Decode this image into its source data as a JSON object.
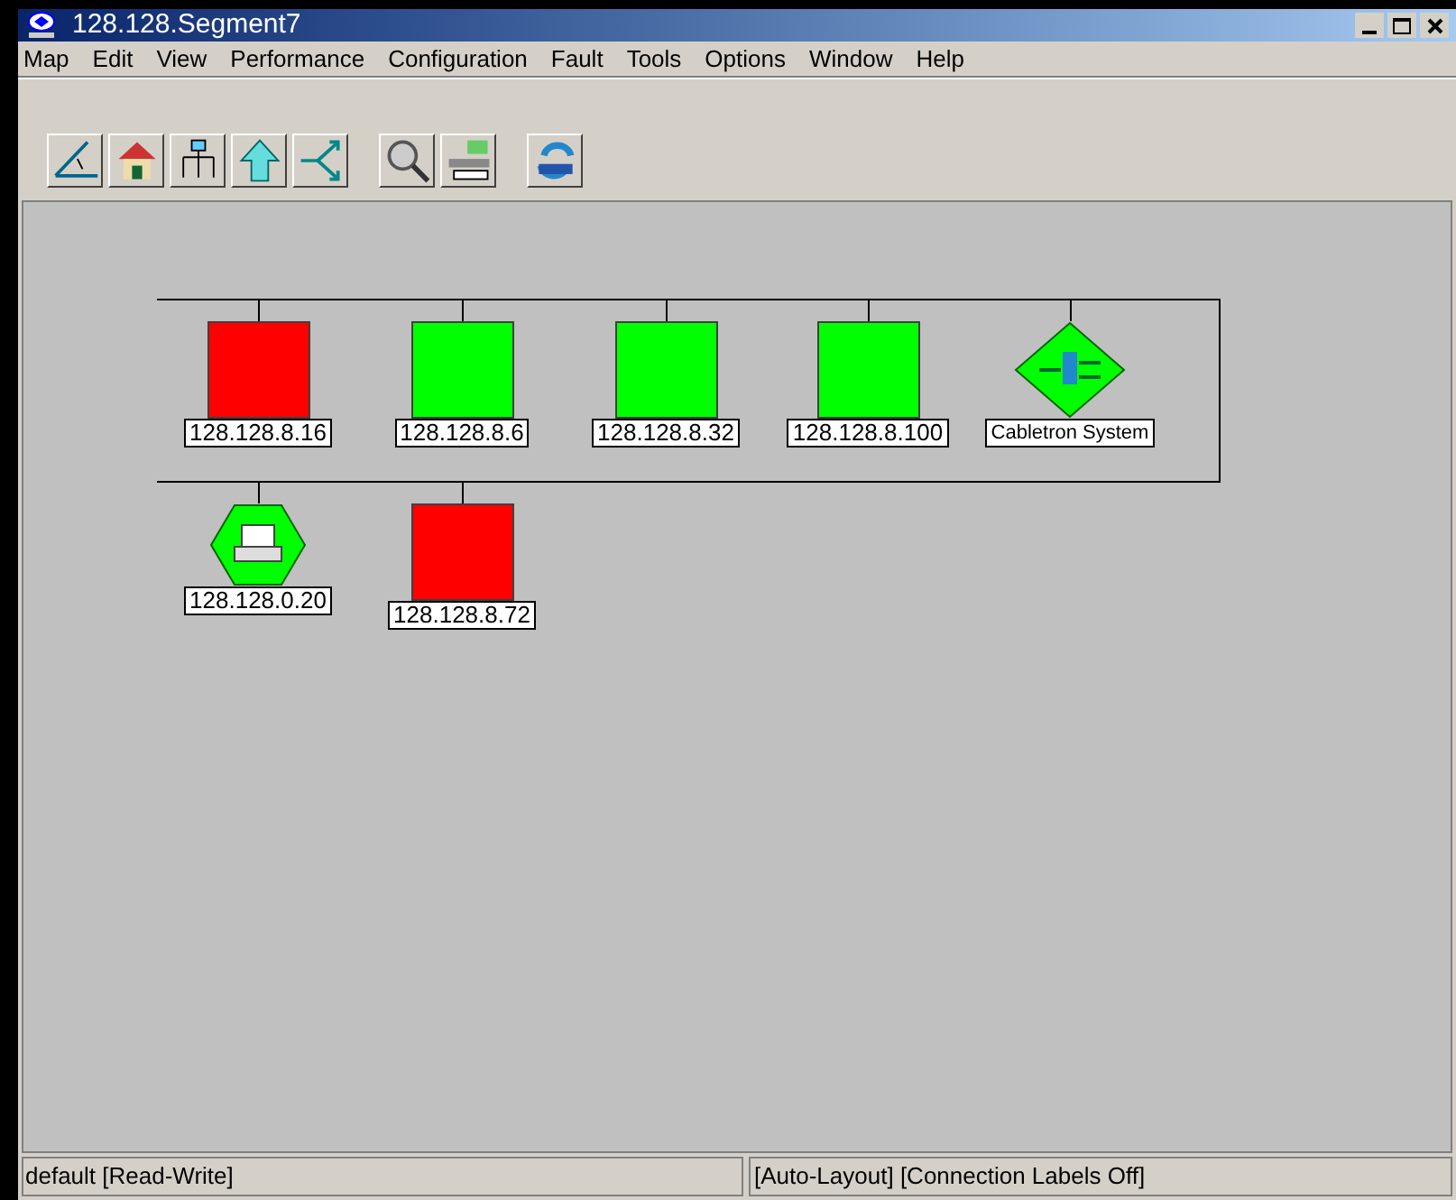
{
  "window": {
    "title": "128.128.Segment7"
  },
  "menu": [
    "Map",
    "Edit",
    "View",
    "Performance",
    "Configuration",
    "Fault",
    "Tools",
    "Options",
    "Window",
    "Help"
  ],
  "map": {
    "segments": [
      {
        "nodes": [
          {
            "kind": "square",
            "color": "#ff0000",
            "label": "128.128.8.16"
          },
          {
            "kind": "square",
            "color": "#00ff00",
            "label": "128.128.8.6"
          },
          {
            "kind": "square",
            "color": "#00ff00",
            "label": "128.128.8.32"
          },
          {
            "kind": "square",
            "color": "#00ff00",
            "label": "128.128.8.100"
          },
          {
            "kind": "diamond",
            "color": "#00ff00",
            "label": "Cabletron System"
          }
        ]
      },
      {
        "nodes": [
          {
            "kind": "hexagon",
            "color": "#00ff00",
            "label": "128.128.0.20"
          },
          {
            "kind": "square",
            "color": "#ff0000",
            "label": "128.128.8.72"
          }
        ]
      }
    ]
  },
  "status_bar": [
    "default [Read-Write]",
    "[Auto-Layout] [Connection Labels Off]"
  ]
}
